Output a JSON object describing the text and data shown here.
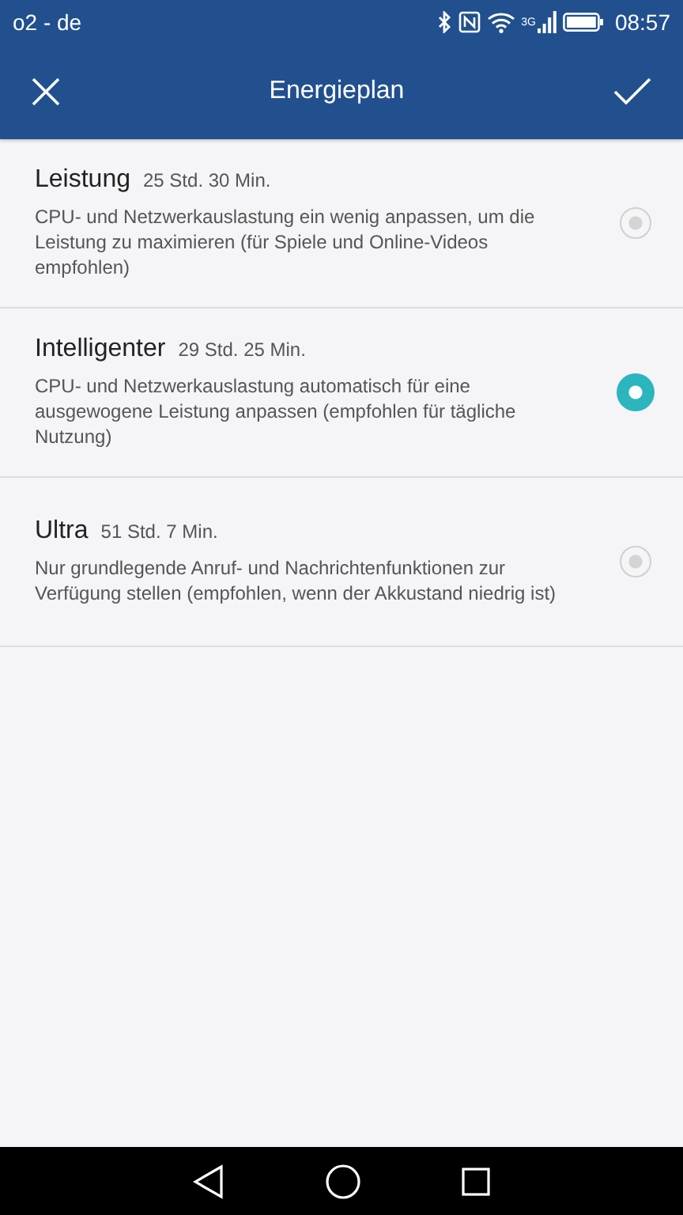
{
  "status_bar": {
    "carrier": "o2 - de",
    "network": "3G",
    "time": "08:57"
  },
  "app_bar": {
    "title": "Energieplan"
  },
  "plans": [
    {
      "name": "Leistung",
      "duration": "25 Std. 30 Min.",
      "description": "CPU- und Netzwerkauslastung ein wenig anpassen, um die Leistung zu maximieren (für Spiele und Online-Videos empfohlen)",
      "selected": false
    },
    {
      "name": "Intelligenter",
      "duration": "29 Std. 25 Min.",
      "description": "CPU- und Netzwerkauslastung automatisch für eine ausgewogene Leistung anpassen (empfohlen für tägliche Nutzung)",
      "selected": true
    },
    {
      "name": "Ultra",
      "duration": "51 Std. 7 Min.",
      "description": "Nur grundlegende Anruf- und Nachrichtenfunktionen zur Verfügung stellen (empfohlen, wenn der Akkustand niedrig ist)",
      "selected": false
    }
  ]
}
